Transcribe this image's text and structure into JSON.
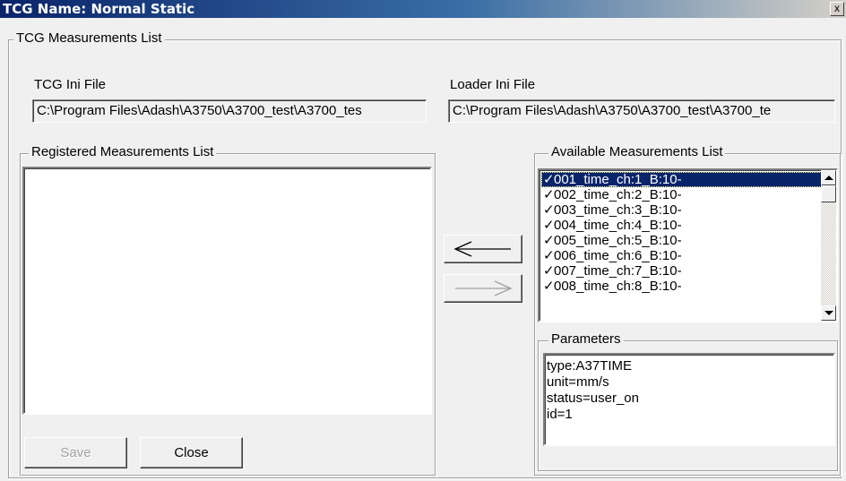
{
  "window": {
    "title": "TCG Name: Normal Static",
    "close_glyph": "x"
  },
  "main_group": {
    "legend": "TCG Measurements List"
  },
  "tcg_ini": {
    "label": "TCG Ini File",
    "value": "C:\\Program Files\\Adash\\A3750\\A3700_test\\A3700_tes"
  },
  "loader_ini": {
    "label": "Loader Ini File",
    "value": "C:\\Program Files\\Adash\\A3750\\A3700_test\\A3700_te"
  },
  "registered": {
    "legend": "Registered Measurements List",
    "items": []
  },
  "available": {
    "legend": "Available Measurements List",
    "items": [
      {
        "check": "✓",
        "label": "001_time_ch:1_B:10-"
      },
      {
        "check": "✓",
        "label": "002_time_ch:2_B:10-"
      },
      {
        "check": "✓",
        "label": "003_time_ch:3_B:10-"
      },
      {
        "check": "✓",
        "label": "004_time_ch:4_B:10-"
      },
      {
        "check": "✓",
        "label": "005_time_ch:5_B:10-"
      },
      {
        "check": "✓",
        "label": "006_time_ch:6_B:10-"
      },
      {
        "check": "✓",
        "label": "007_time_ch:7_B:10-"
      },
      {
        "check": "✓",
        "label": "008_time_ch:8_B:10-"
      }
    ],
    "selected_index": 0
  },
  "parameters": {
    "legend": "Parameters",
    "lines": [
      "type:A37TIME",
      "unit=mm/s",
      "status=user_on",
      "id=1"
    ]
  },
  "buttons": {
    "save": "Save",
    "close": "Close",
    "move_left_icon": "arrow-left-icon",
    "move_right_icon": "arrow-right-icon"
  },
  "colors": {
    "title_gradient_start": "#0a246a",
    "selection": "#0a246a",
    "face": "#f0f0f0"
  }
}
